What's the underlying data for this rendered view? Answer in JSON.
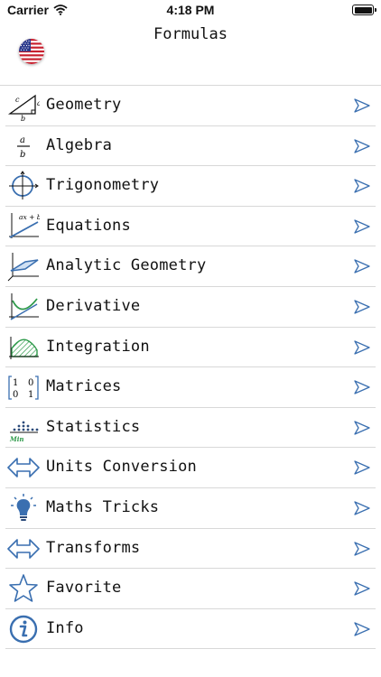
{
  "status_bar": {
    "carrier": "Carrier",
    "time": "4:18 PM"
  },
  "nav": {
    "title": "Formulas"
  },
  "flag_icon": "us-flag-icon",
  "icon_color": "#3a6fb0",
  "items": [
    {
      "label": "Geometry",
      "icon": "right-triangle-icon"
    },
    {
      "label": "Algebra",
      "icon": "fraction-icon"
    },
    {
      "label": "Trigonometry",
      "icon": "unit-circle-icon"
    },
    {
      "label": "Equations",
      "icon": "linear-graph-icon"
    },
    {
      "label": "Analytic Geometry",
      "icon": "plane-icon"
    },
    {
      "label": "Derivative",
      "icon": "tangent-curve-icon"
    },
    {
      "label": "Integration",
      "icon": "shaded-area-icon"
    },
    {
      "label": "Matrices",
      "icon": "matrix-icon"
    },
    {
      "label": "Statistics",
      "icon": "dot-plot-icon"
    },
    {
      "label": "Units Conversion",
      "icon": "double-arrow-icon"
    },
    {
      "label": "Maths Tricks",
      "icon": "lightbulb-icon"
    },
    {
      "label": "Transforms",
      "icon": "double-arrow-icon"
    },
    {
      "label": "Favorite",
      "icon": "star-icon"
    },
    {
      "label": "Info",
      "icon": "info-icon"
    }
  ],
  "icon_text": {
    "triangle_c": "c",
    "triangle_a": "a",
    "triangle_b": "b",
    "fraction_num": "a",
    "fraction_den": "b",
    "equation": "ax + b",
    "matrix_r1c1": "1",
    "matrix_r1c2": "0",
    "matrix_r2c1": "0",
    "matrix_r2c2": "1",
    "stats_min": "Min"
  }
}
